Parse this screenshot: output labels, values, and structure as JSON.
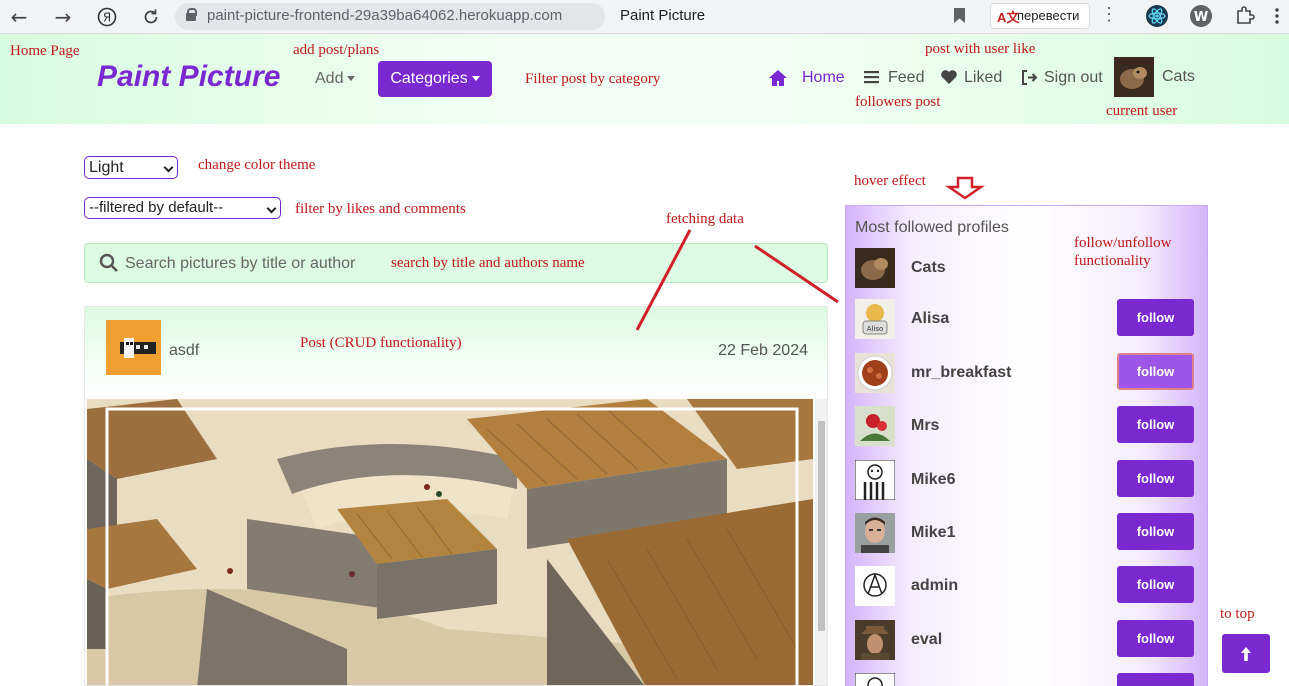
{
  "browser": {
    "url": "paint-picture-frontend-29a39ba64062.herokuapp.com",
    "tab_title": "Paint Picture",
    "translate_label": "перевести"
  },
  "navbar": {
    "brand": "Paint Picture",
    "add_label": "Add",
    "categories_label": "Categories",
    "home_label": "Home",
    "feed_label": "Feed",
    "liked_label": "Liked",
    "signout_label": "Sign out",
    "current_user": "Cats"
  },
  "controls": {
    "theme_value": "Light",
    "filter_value": "--filtered by default--",
    "search_placeholder": "Search pictures by title or author"
  },
  "post": {
    "author": "asdf",
    "date": "22 Feb 2024"
  },
  "sidebar": {
    "title": "Most followed profiles",
    "profiles": [
      {
        "name": "Cats",
        "follow_label": ""
      },
      {
        "name": "Alisa",
        "follow_label": "follow"
      },
      {
        "name": "mr_breakfast",
        "follow_label": "follow"
      },
      {
        "name": "Mrs",
        "follow_label": "follow"
      },
      {
        "name": "Mike6",
        "follow_label": "follow"
      },
      {
        "name": "Mike1",
        "follow_label": "follow"
      },
      {
        "name": "admin",
        "follow_label": "follow"
      },
      {
        "name": "eval",
        "follow_label": "follow"
      }
    ]
  },
  "annotations": {
    "home_page": "Home Page",
    "add_post": "add post/plans",
    "post_with_like": "post with user like",
    "filter_category": "Filter post by category",
    "followers_post": "followers post",
    "current_user": "current user",
    "color_theme": "change color theme",
    "hover_effect": "hover effect",
    "filter_likes": "filter by likes and comments",
    "fetching_data": "fetching data",
    "follow_unfollow_1": "follow/unfollow",
    "follow_unfollow_2": "functionality",
    "search_title": "search by title and authors name",
    "post_crud": "Post (CRUD functionality)",
    "to_top": "to top"
  },
  "colors": {
    "accent": "#7a28d0",
    "annotation": "#c0181b",
    "navbar_bg": "#dcfbe2"
  }
}
